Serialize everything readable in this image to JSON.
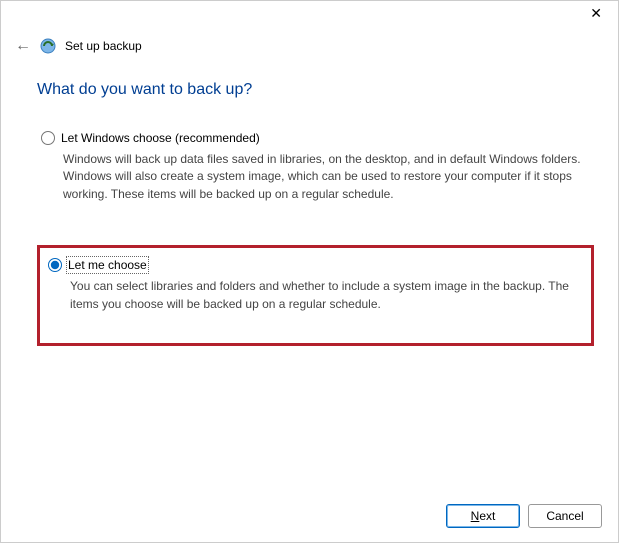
{
  "window": {
    "title": "Set up backup"
  },
  "heading": "What do you want to back up?",
  "options": {
    "recommended": {
      "label": "Let Windows choose (recommended)",
      "description": "Windows will back up data files saved in libraries, on the desktop, and in default Windows folders. Windows will also create a system image, which can be used to restore your computer if it stops working. These items will be backed up on a regular schedule.",
      "selected": false
    },
    "custom": {
      "label": "Let me choose",
      "description": "You can select libraries and folders and whether to include a system image in the backup. The items you choose will be backed up on a regular schedule.",
      "selected": true
    }
  },
  "buttons": {
    "next_prefix": "N",
    "next_rest": "ext",
    "cancel": "Cancel"
  }
}
